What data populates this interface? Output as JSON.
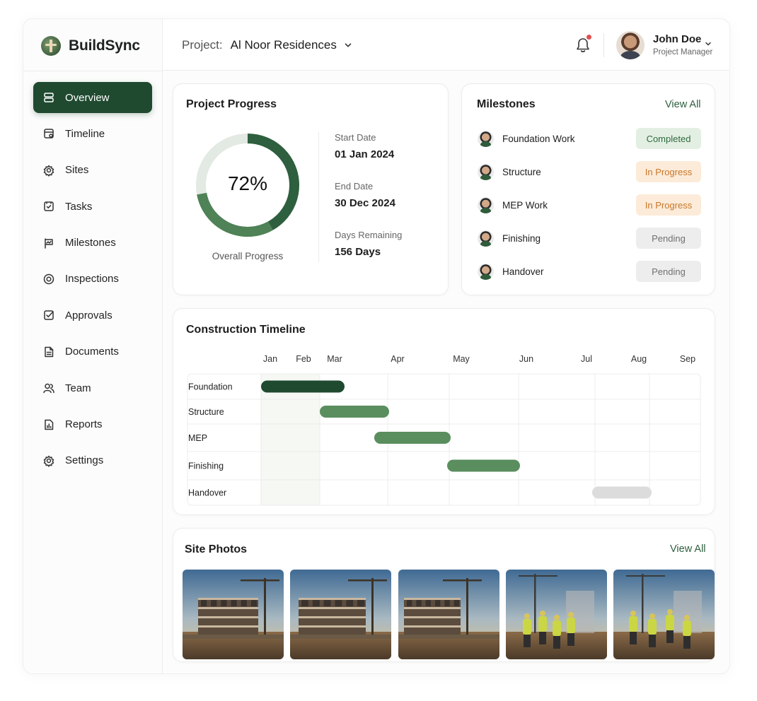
{
  "brand": {
    "name": "BuildSync"
  },
  "nav": [
    {
      "label": "Overview",
      "icon": "overview-icon",
      "active": true
    },
    {
      "label": "Timeline",
      "icon": "timeline-icon"
    },
    {
      "label": "Sites",
      "icon": "sites-icon"
    },
    {
      "label": "Tasks",
      "icon": "tasks-icon"
    },
    {
      "label": "Milestones",
      "icon": "milestones-icon"
    },
    {
      "label": "Inspections",
      "icon": "inspections-icon"
    },
    {
      "label": "Approvals",
      "icon": "approvals-icon"
    },
    {
      "label": "Documents",
      "icon": "documents-icon"
    },
    {
      "label": "Team",
      "icon": "team-icon"
    },
    {
      "label": "Reports",
      "icon": "reports-icon"
    },
    {
      "label": "Settings",
      "icon": "settings-icon"
    }
  ],
  "header": {
    "project_label": "Project:",
    "project_name": "Al Noor Residences",
    "user_name": "John Doe",
    "user_role": "Project Manager"
  },
  "progress": {
    "title": "Project Progress",
    "percent_text": "72%",
    "percent": 72,
    "caption": "Overall Progress",
    "start_label": "Start Date",
    "start_value": "01 Jan 2024",
    "end_label": "End Date",
    "end_value": "30 Dec 2024",
    "remaining_label": "Days Remaining",
    "remaining_value": "156 Days"
  },
  "milestones": {
    "title": "Milestones",
    "view_all": "View All",
    "items": [
      {
        "name": "Foundation Work",
        "status": "Completed"
      },
      {
        "name": "Structure",
        "status": "In Progress"
      },
      {
        "name": "MEP Work",
        "status": "In Progress"
      },
      {
        "name": "Finishing",
        "status": "Pending"
      },
      {
        "name": "Handover",
        "status": "Pending"
      }
    ]
  },
  "timeline": {
    "title": "Construction Timeline",
    "months": [
      "Jan",
      "Feb",
      "Mar",
      "Apr",
      "May",
      "Jun",
      "Jul",
      "Aug",
      "Sep"
    ],
    "tasks": [
      {
        "name": "Foundation",
        "start": "Jan",
        "end": "Mar",
        "state": "done"
      },
      {
        "name": "Structure",
        "start": "Mar",
        "end": "Apr",
        "state": "active"
      },
      {
        "name": "MEP",
        "start": "Apr",
        "end": "May",
        "state": "active"
      },
      {
        "name": "Finishing",
        "start": "May",
        "end": "Jun",
        "state": "active"
      },
      {
        "name": "Handover",
        "start": "Jul",
        "end": "Aug",
        "state": "pending"
      }
    ]
  },
  "photos": {
    "title": "Site Photos",
    "view_all": "View All",
    "count": 5
  },
  "colors": {
    "brand_dark": "#1f4a30",
    "bar_done": "#1f4a30",
    "bar_active": "#5a8e5e",
    "bar_pending": "#dcdcdc",
    "completed_bg": "#e3efe3",
    "progress_bg": "#fcebd8",
    "pending_bg": "#ededed"
  }
}
